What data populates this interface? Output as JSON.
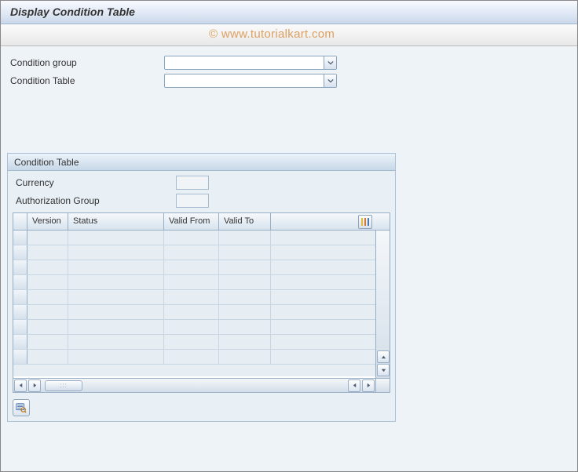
{
  "title": "Display Condition Table",
  "watermark": "© www.tutorialkart.com",
  "fields": {
    "condition_group": {
      "label": "Condition group",
      "value": ""
    },
    "condition_table": {
      "label": "Condition Table",
      "value": ""
    }
  },
  "panel": {
    "title": "Condition Table",
    "currency": {
      "label": "Currency",
      "value": ""
    },
    "auth_group": {
      "label": "Authorization Group",
      "value": ""
    }
  },
  "grid": {
    "columns": {
      "version": "Version",
      "status": "Status",
      "valid_from": "Valid From",
      "valid_to": "Valid To"
    },
    "rows": [
      {},
      {},
      {},
      {},
      {},
      {},
      {},
      {},
      {}
    ]
  },
  "icons": {
    "config": "config-columns-icon",
    "search": "search-detail-icon"
  }
}
